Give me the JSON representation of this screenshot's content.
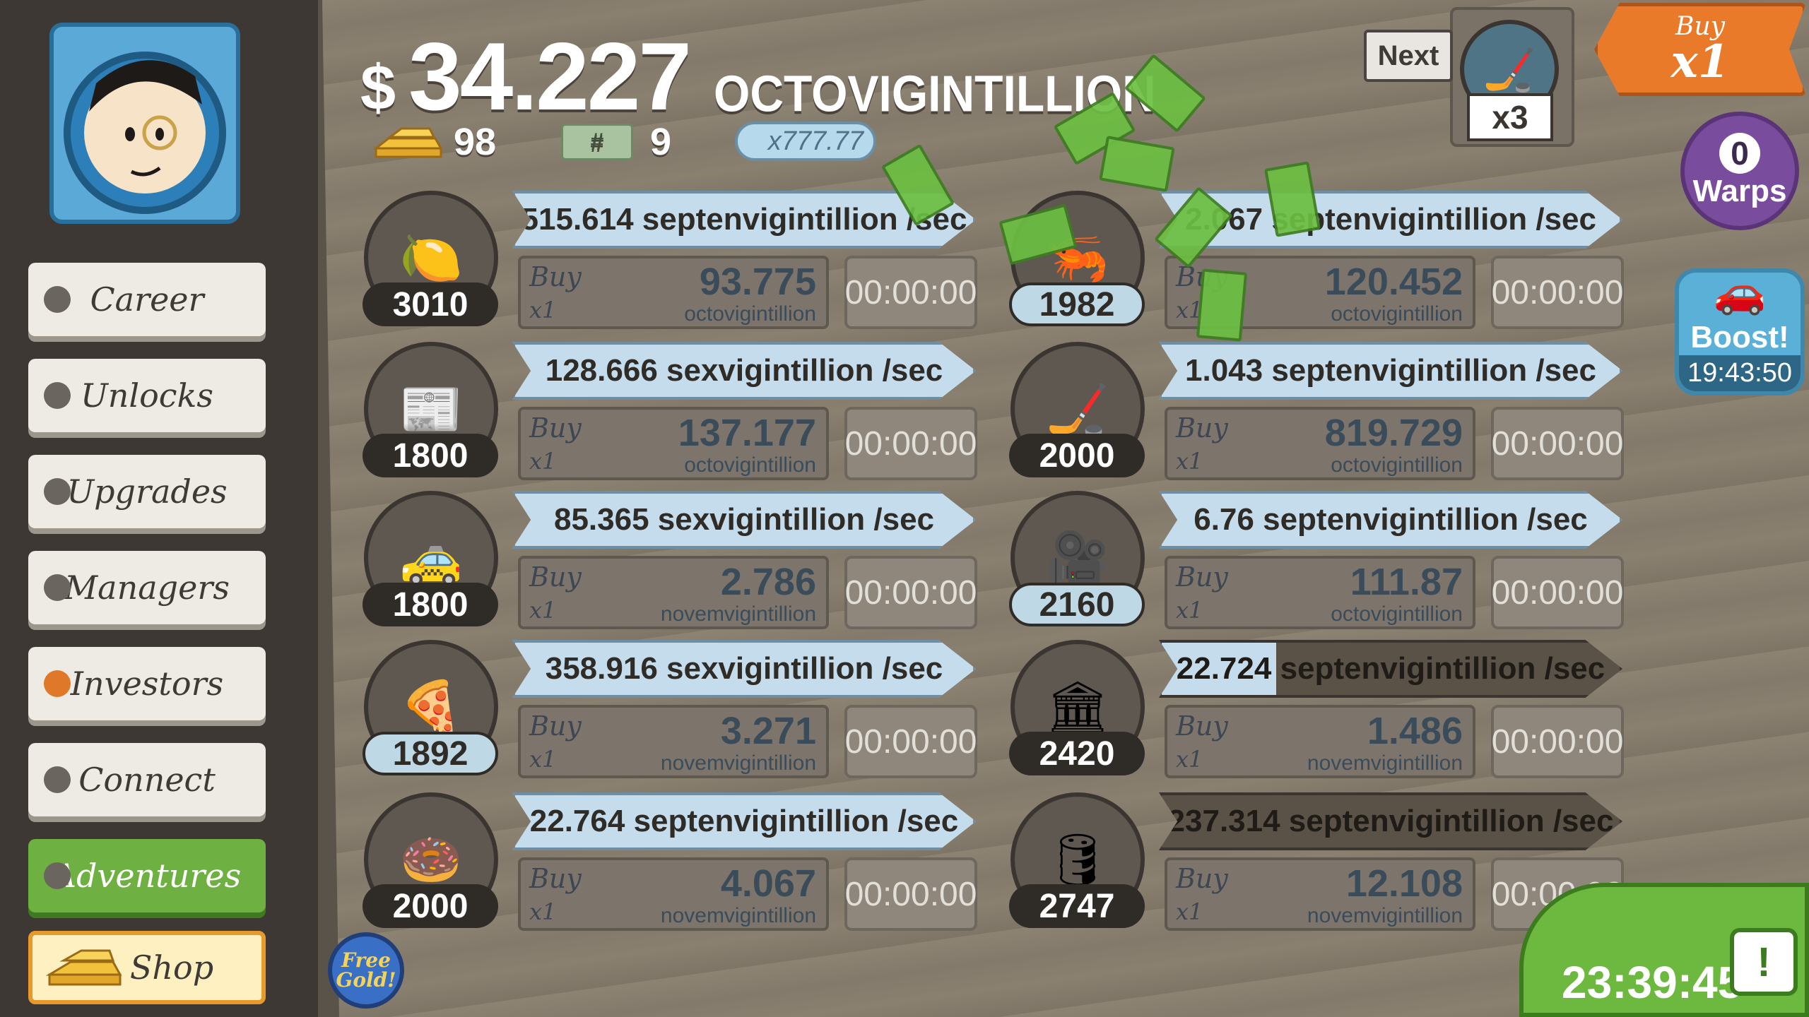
{
  "header": {
    "currency_symbol": "$",
    "balance": "34.227",
    "balance_unit": "OCTOVIGINTILLION",
    "gold_count": "98",
    "megaticket_count": "9",
    "multiplier_ticket": "x777.77"
  },
  "next_unlock": {
    "label": "Next",
    "multiplier": "x3"
  },
  "buy_multiplier": {
    "line1": "Buy",
    "line2": "x1"
  },
  "warps": {
    "count": "0",
    "label": "Warps"
  },
  "boost": {
    "label": "Boost!",
    "time": "19:43:50"
  },
  "sidebar": {
    "items": [
      {
        "label": "Career"
      },
      {
        "label": "Unlocks"
      },
      {
        "label": "Upgrades"
      },
      {
        "label": "Managers"
      },
      {
        "label": "Investors"
      },
      {
        "label": "Connect"
      },
      {
        "label": "Adventures"
      },
      {
        "label": "Shop"
      }
    ]
  },
  "businesses": [
    {
      "icon": "lemon-icon",
      "glyph": "🍋",
      "owned": "3010",
      "revenue": "515.614 septenvigintillion /sec",
      "buy_label": "Buy",
      "buy_qty": "x1",
      "cost": "93.775",
      "cost_unit": "octovigintillion",
      "timer": "00:00:00",
      "progress": 1.0
    },
    {
      "icon": "newspaper-icon",
      "glyph": "📰",
      "owned": "1800",
      "revenue": "128.666 sexvigintillion /sec",
      "buy_label": "Buy",
      "buy_qty": "x1",
      "cost": "137.177",
      "cost_unit": "octovigintillion",
      "timer": "00:00:00",
      "progress": 1.0
    },
    {
      "icon": "car-wash-icon",
      "glyph": "🚕",
      "owned": "1800",
      "revenue": "85.365 sexvigintillion /sec",
      "buy_label": "Buy",
      "buy_qty": "x1",
      "cost": "2.786",
      "cost_unit": "novemvigintillion",
      "timer": "00:00:00",
      "progress": 1.0
    },
    {
      "icon": "pizza-icon",
      "glyph": "🍕",
      "owned": "1892",
      "revenue": "358.916 sexvigintillion /sec",
      "buy_label": "Buy",
      "buy_qty": "x1",
      "cost": "3.271",
      "cost_unit": "novemvigintillion",
      "timer": "00:00:00",
      "progress": 1.0
    },
    {
      "icon": "donut-icon",
      "glyph": "🍩",
      "owned": "2000",
      "revenue": "22.764 septenvigintillion /sec",
      "buy_label": "Buy",
      "buy_qty": "x1",
      "cost": "4.067",
      "cost_unit": "novemvigintillion",
      "timer": "00:00:00",
      "progress": 1.0
    },
    {
      "icon": "shrimp-icon",
      "glyph": "🦐",
      "owned": "1982",
      "revenue": "2.067 septenvigintillion /sec",
      "buy_label": "Buy",
      "buy_qty": "x1",
      "cost": "120.452",
      "cost_unit": "octovigintillion",
      "timer": "00:00:00",
      "progress": 1.0
    },
    {
      "icon": "hockey-icon",
      "glyph": "🏒",
      "owned": "2000",
      "revenue": "1.043 septenvigintillion /sec",
      "buy_label": "Buy",
      "buy_qty": "x1",
      "cost": "819.729",
      "cost_unit": "octovigintillion",
      "timer": "00:00:00",
      "progress": 1.0
    },
    {
      "icon": "movie-camera-icon",
      "glyph": "🎥",
      "owned": "2160",
      "revenue": "6.76 septenvigintillion /sec",
      "buy_label": "Buy",
      "buy_qty": "x1",
      "cost": "111.87",
      "cost_unit": "octovigintillion",
      "timer": "00:00:00",
      "progress": 1.0
    },
    {
      "icon": "bank-icon",
      "glyph": "🏛",
      "owned": "2420",
      "revenue": "22.724 septenvigintillion /sec",
      "buy_label": "Buy",
      "buy_qty": "x1",
      "cost": "1.486",
      "cost_unit": "novemvigintillion",
      "timer": "00:00:00",
      "progress": 0.25
    },
    {
      "icon": "oil-derrick-icon",
      "glyph": "🛢",
      "owned": "2747",
      "revenue": "237.314 septenvigintillion /sec",
      "buy_label": "Buy",
      "buy_qty": "x1",
      "cost": "12.108",
      "cost_unit": "novemvigintillion",
      "timer": "00:00:02",
      "progress": 0.0
    }
  ],
  "free_gold": {
    "label": "Free Gold!"
  },
  "tv_timer": {
    "time": "23:39:45"
  },
  "colors": {
    "accent_orange": "#e97a2a",
    "adventures_green": "#6fb042",
    "progress_blue": "#c4dceb"
  }
}
